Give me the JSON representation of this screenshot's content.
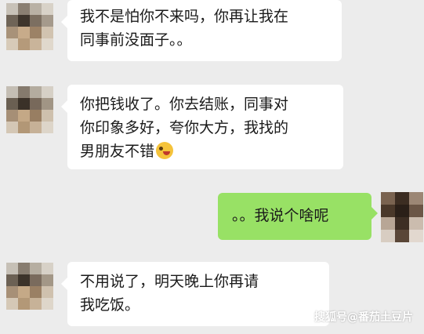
{
  "messages": [
    {
      "side": "left",
      "lines": [
        "我不是怕你不来吗，你再让我在",
        "同事前没面子。。"
      ]
    },
    {
      "side": "left",
      "lines": [
        "你把钱收了。你去结账，同事对",
        "你印象多好，夸你大方，我找的",
        "男朋友不错"
      ],
      "emoji": "grinning-face-emoji"
    },
    {
      "side": "right",
      "lines": [
        "。。我说个啥呢"
      ]
    },
    {
      "side": "left",
      "lines": [
        "不用说了，明天晚上你再请",
        "我吃饭。"
      ]
    }
  ],
  "watermark": "搜狐号@番茄土豆片",
  "colors": {
    "background": "#ececec",
    "incoming_bubble": "#ffffff",
    "outgoing_bubble": "#98e165"
  }
}
